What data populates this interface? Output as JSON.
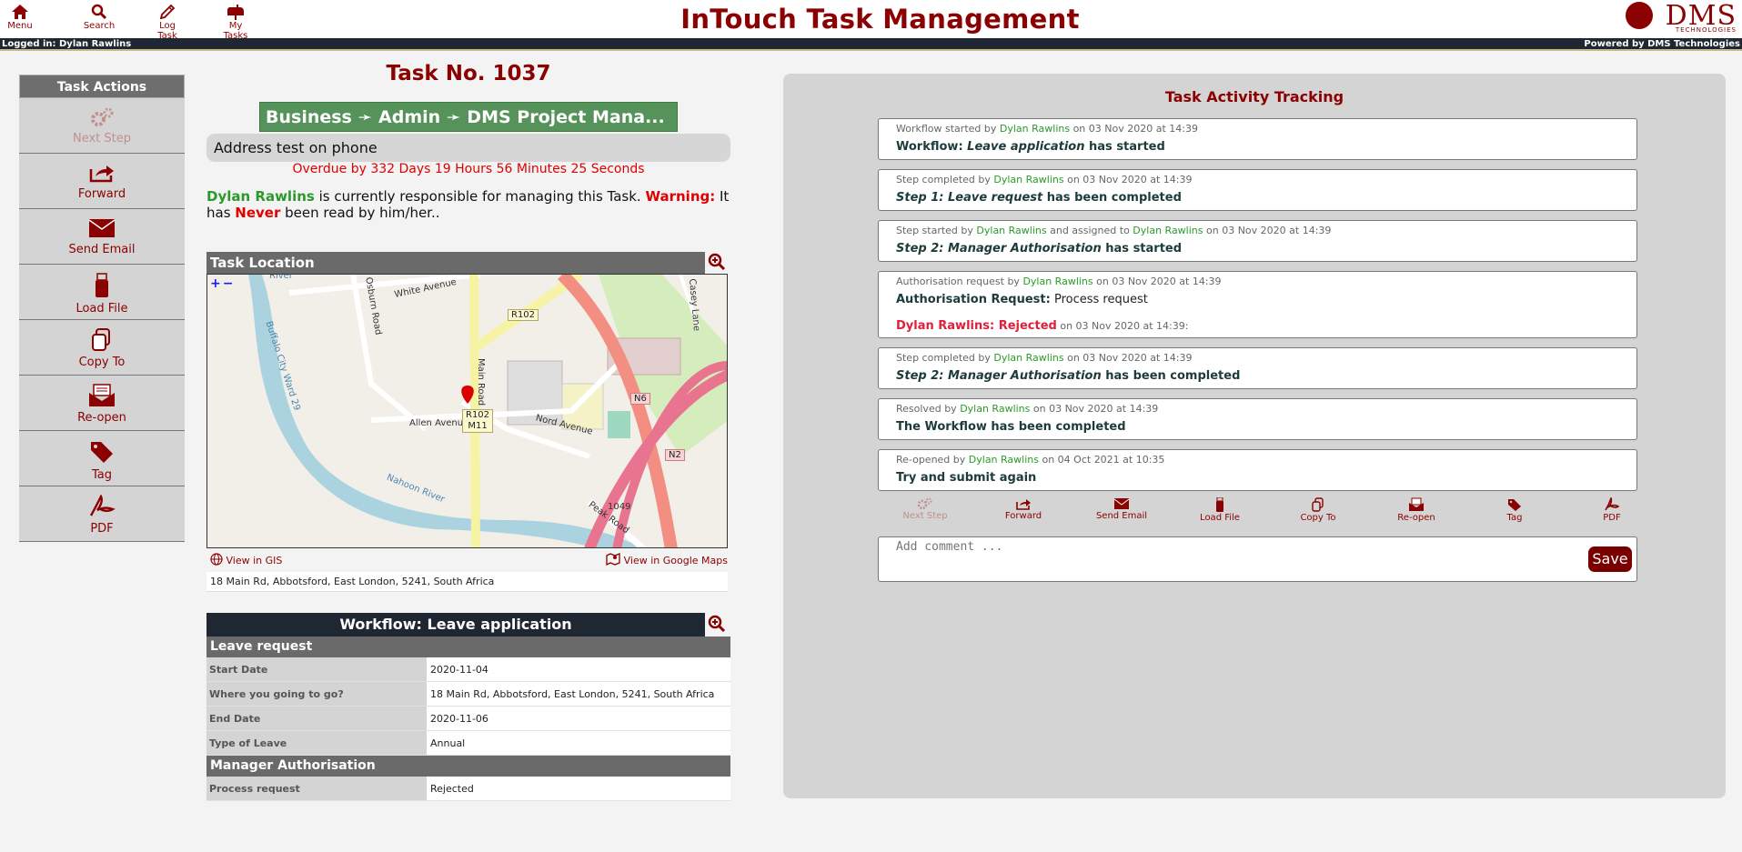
{
  "header": {
    "nav": [
      {
        "label": "Menu",
        "icon": "home-icon"
      },
      {
        "label": "Search",
        "icon": "search-icon"
      },
      {
        "label": "Log Task",
        "icon": "pencil-icon"
      },
      {
        "label": "My Tasks",
        "icon": "mailbox-icon"
      }
    ],
    "title": "InTouch Task Management",
    "brand_main": "DMS",
    "brand_sub": "TECHNOLOGIES"
  },
  "status": {
    "logged_in": "Logged in: Dylan Rawlins",
    "powered_by": "Powered by DMS Technologies"
  },
  "actions": {
    "title": "Task Actions",
    "items": [
      {
        "label": "Next Step",
        "icon": "gears-icon",
        "enabled": false
      },
      {
        "label": "Forward",
        "icon": "forward-icon",
        "enabled": true
      },
      {
        "label": "Send Email",
        "icon": "envelope-icon",
        "enabled": true
      },
      {
        "label": "Load File",
        "icon": "usb-drive-icon",
        "enabled": true
      },
      {
        "label": "Copy To",
        "icon": "copy-icon",
        "enabled": true
      },
      {
        "label": "Re-open",
        "icon": "open-envelope-icon",
        "enabled": true
      },
      {
        "label": "Tag",
        "icon": "tag-icon",
        "enabled": true
      },
      {
        "label": "PDF",
        "icon": "pdf-icon",
        "enabled": true
      }
    ]
  },
  "task": {
    "number": "Task No. 1037",
    "breadcrumb": "Business ➛ Admin ➛ DMS Project Mana...",
    "subject": "Address test on phone",
    "overdue": "Overdue by 332 Days 19 Hours 56 Minutes 25 Seconds",
    "resp_user": "Dylan Rawlins",
    "resp_text1": " is currently responsible for managing this Task. ",
    "resp_warning": "Warning:",
    "resp_text2": " It has ",
    "resp_never": "Never",
    "resp_text3": " been read by him/her.."
  },
  "location": {
    "title": "Task Location",
    "zoom_controls": "+−",
    "map_labels": {
      "river": "River",
      "buffalo": "Buffalo City Ward 29",
      "white_avenue": "White Avenue",
      "osburn": "Osburn Road",
      "main_road": "Main Road",
      "allen": "Allen Avenue",
      "nord": "Nord Avenue",
      "nahoon": "Nahoon River",
      "casey": "Casey Lane",
      "peak": "Peak Road",
      "r102": "R102",
      "r102_m11": "R102\nM11",
      "n6": "N6",
      "n2": "N2",
      "num1049": "1049"
    },
    "view_gis": "View in GIS",
    "view_google": "View in Google Maps",
    "address": "18 Main Rd, Abbotsford, East London, 5241, South Africa"
  },
  "workflow": {
    "title": "Workflow: Leave application",
    "sections": [
      {
        "name": "Leave request",
        "rows": [
          {
            "label": "Start Date",
            "value": "2020-11-04"
          },
          {
            "label": "Where you going to go?",
            "value": "18 Main Rd, Abbotsford, East London, 5241, South Africa"
          },
          {
            "label": "End Date",
            "value": "2020-11-06"
          },
          {
            "label": "Type of Leave",
            "value": "Annual"
          }
        ]
      },
      {
        "name": "Manager Authorisation",
        "rows": [
          {
            "label": "Process request",
            "value": "Rejected"
          }
        ]
      }
    ]
  },
  "activity": {
    "title": "Task Activity Tracking",
    "items": [
      {
        "m1": "Workflow started by ",
        "u1": "Dylan Rawlins",
        "m2": " on 03 Nov 2020 at 14:39",
        "pre": "Workflow: ",
        "em": "Leave application",
        "post": " has started"
      },
      {
        "m1": "Step completed by ",
        "u1": "Dylan Rawlins",
        "m2": " on 03 Nov 2020 at 14:39",
        "pre": "",
        "em": "Step 1: Leave request",
        "post": " has been completed"
      },
      {
        "m1": "Step started by ",
        "u1": "Dylan Rawlins",
        "m2": " and assigned to ",
        "u2": "Dylan Rawlins",
        "m3": " on 03 Nov 2020 at 14:39",
        "pre": "",
        "em": "Step 2: Manager Authorisation",
        "post": " has started"
      },
      {
        "m1": "Authorisation request by ",
        "u1": "Dylan Rawlins",
        "m2": " on 03 Nov 2020 at 14:39",
        "pre": "Authorisation Request:",
        "plain": " Process request",
        "reject_who": "Dylan Rawlins: Rejected",
        "reject_when": " on 03 Nov 2020 at 14:39:"
      },
      {
        "m1": "Step completed by ",
        "u1": "Dylan Rawlins",
        "m2": " on 03 Nov 2020 at 14:39",
        "pre": "",
        "em": "Step 2: Manager Authorisation",
        "post": " has been completed"
      },
      {
        "m1": "Resolved by ",
        "u1": "Dylan Rawlins",
        "m2": " on 03 Nov 2020 at 14:39",
        "pre": "The Workflow has been completed",
        "em": "",
        "post": ""
      },
      {
        "m1": "Re-opened by ",
        "u1": "Dylan Rawlins",
        "m2": " on 04 Oct 2021 at 10:35",
        "pre": "Try and submit again",
        "em": "",
        "post": ""
      }
    ],
    "toolbar": [
      {
        "label": "Next Step",
        "icon": "gears-icon",
        "enabled": false
      },
      {
        "label": "Forward",
        "icon": "forward-icon",
        "enabled": true
      },
      {
        "label": "Send Email",
        "icon": "envelope-icon",
        "enabled": true
      },
      {
        "label": "Load File",
        "icon": "usb-drive-icon",
        "enabled": true
      },
      {
        "label": "Copy To",
        "icon": "copy-icon",
        "enabled": true
      },
      {
        "label": "Re-open",
        "icon": "open-envelope-icon",
        "enabled": true
      },
      {
        "label": "Tag",
        "icon": "tag-icon",
        "enabled": true
      },
      {
        "label": "PDF",
        "icon": "pdf-icon",
        "enabled": true
      }
    ],
    "comment_placeholder": "Add comment ...",
    "save_label": "Save"
  },
  "colors": {
    "brand": "#8b0000",
    "user_green": "#2a9a2a",
    "warning_red": "#e00000",
    "breadcrumb_green": "#55935a",
    "dark_bar": "#1f2733"
  }
}
